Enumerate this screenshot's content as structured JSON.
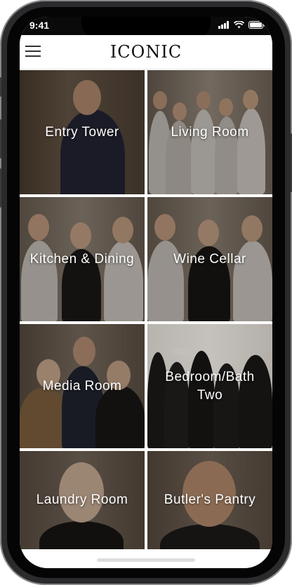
{
  "status": {
    "time": "9:41"
  },
  "header": {
    "logo": "ICONIC"
  },
  "tiles": [
    {
      "label": "Entry Tower"
    },
    {
      "label": "Living Room"
    },
    {
      "label": "Kitchen & Dining"
    },
    {
      "label": "Wine Cellar"
    },
    {
      "label": "Media Room"
    },
    {
      "label": "Bedroom/Bath Two"
    },
    {
      "label": "Laundry Room"
    },
    {
      "label": "Butler's Pantry"
    }
  ],
  "colors": {
    "wood_dark": "#5a4a3c",
    "wood_light": "#8a7d70",
    "text": "#ffffff"
  },
  "icons": [
    "menu-icon",
    "signal-icon",
    "wifi-icon",
    "battery-icon"
  ]
}
